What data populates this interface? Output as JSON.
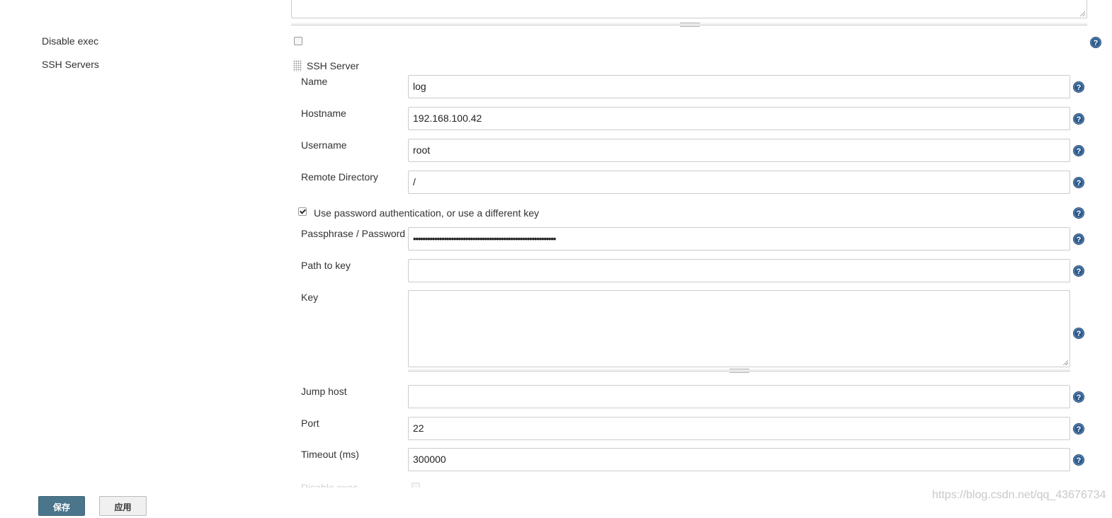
{
  "top": {
    "disable_exec_label": "Disable exec",
    "ssh_servers_label": "SSH Servers"
  },
  "server": {
    "header": "SSH Server",
    "name": {
      "label": "Name",
      "value": "log"
    },
    "hostname": {
      "label": "Hostname",
      "value": "192.168.100.42"
    },
    "username": {
      "label": "Username",
      "value": "root"
    },
    "remote_directory": {
      "label": "Remote Directory",
      "value": "/"
    },
    "use_password_label": "Use password authentication, or use a different key",
    "use_password_checked": true,
    "passphrase": {
      "label": "Passphrase / Password",
      "value": "••••••••••••••••••••••••••••••••••••••••••••••••••••••••••••"
    },
    "path_to_key": {
      "label": "Path to key",
      "value": ""
    },
    "key": {
      "label": "Key",
      "value": ""
    },
    "jump_host": {
      "label": "Jump host",
      "value": ""
    },
    "port": {
      "label": "Port",
      "value": "22"
    },
    "timeout": {
      "label": "Timeout (ms)",
      "value": "300000"
    },
    "disable_exec_label": "Disable exec"
  },
  "buttons": {
    "save": "保存",
    "apply": "应用"
  },
  "help_glyph": "?",
  "watermark": "https://blog.csdn.net/qq_43676734",
  "colors": {
    "save_button": "#4b758b",
    "help_icon": "#2c5a8c"
  }
}
